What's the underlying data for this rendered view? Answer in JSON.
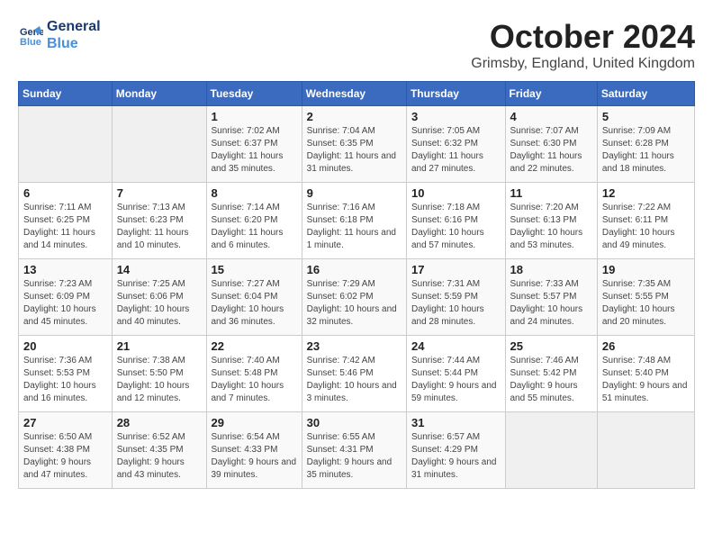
{
  "header": {
    "logo_line1": "General",
    "logo_line2": "Blue",
    "month_title": "October 2024",
    "subtitle": "Grimsby, England, United Kingdom"
  },
  "weekdays": [
    "Sunday",
    "Monday",
    "Tuesday",
    "Wednesday",
    "Thursday",
    "Friday",
    "Saturday"
  ],
  "weeks": [
    [
      {
        "day": "",
        "sunrise": "",
        "sunset": "",
        "daylight": ""
      },
      {
        "day": "",
        "sunrise": "",
        "sunset": "",
        "daylight": ""
      },
      {
        "day": "1",
        "sunrise": "Sunrise: 7:02 AM",
        "sunset": "Sunset: 6:37 PM",
        "daylight": "Daylight: 11 hours and 35 minutes."
      },
      {
        "day": "2",
        "sunrise": "Sunrise: 7:04 AM",
        "sunset": "Sunset: 6:35 PM",
        "daylight": "Daylight: 11 hours and 31 minutes."
      },
      {
        "day": "3",
        "sunrise": "Sunrise: 7:05 AM",
        "sunset": "Sunset: 6:32 PM",
        "daylight": "Daylight: 11 hours and 27 minutes."
      },
      {
        "day": "4",
        "sunrise": "Sunrise: 7:07 AM",
        "sunset": "Sunset: 6:30 PM",
        "daylight": "Daylight: 11 hours and 22 minutes."
      },
      {
        "day": "5",
        "sunrise": "Sunrise: 7:09 AM",
        "sunset": "Sunset: 6:28 PM",
        "daylight": "Daylight: 11 hours and 18 minutes."
      }
    ],
    [
      {
        "day": "6",
        "sunrise": "Sunrise: 7:11 AM",
        "sunset": "Sunset: 6:25 PM",
        "daylight": "Daylight: 11 hours and 14 minutes."
      },
      {
        "day": "7",
        "sunrise": "Sunrise: 7:13 AM",
        "sunset": "Sunset: 6:23 PM",
        "daylight": "Daylight: 11 hours and 10 minutes."
      },
      {
        "day": "8",
        "sunrise": "Sunrise: 7:14 AM",
        "sunset": "Sunset: 6:20 PM",
        "daylight": "Daylight: 11 hours and 6 minutes."
      },
      {
        "day": "9",
        "sunrise": "Sunrise: 7:16 AM",
        "sunset": "Sunset: 6:18 PM",
        "daylight": "Daylight: 11 hours and 1 minute."
      },
      {
        "day": "10",
        "sunrise": "Sunrise: 7:18 AM",
        "sunset": "Sunset: 6:16 PM",
        "daylight": "Daylight: 10 hours and 57 minutes."
      },
      {
        "day": "11",
        "sunrise": "Sunrise: 7:20 AM",
        "sunset": "Sunset: 6:13 PM",
        "daylight": "Daylight: 10 hours and 53 minutes."
      },
      {
        "day": "12",
        "sunrise": "Sunrise: 7:22 AM",
        "sunset": "Sunset: 6:11 PM",
        "daylight": "Daylight: 10 hours and 49 minutes."
      }
    ],
    [
      {
        "day": "13",
        "sunrise": "Sunrise: 7:23 AM",
        "sunset": "Sunset: 6:09 PM",
        "daylight": "Daylight: 10 hours and 45 minutes."
      },
      {
        "day": "14",
        "sunrise": "Sunrise: 7:25 AM",
        "sunset": "Sunset: 6:06 PM",
        "daylight": "Daylight: 10 hours and 40 minutes."
      },
      {
        "day": "15",
        "sunrise": "Sunrise: 7:27 AM",
        "sunset": "Sunset: 6:04 PM",
        "daylight": "Daylight: 10 hours and 36 minutes."
      },
      {
        "day": "16",
        "sunrise": "Sunrise: 7:29 AM",
        "sunset": "Sunset: 6:02 PM",
        "daylight": "Daylight: 10 hours and 32 minutes."
      },
      {
        "day": "17",
        "sunrise": "Sunrise: 7:31 AM",
        "sunset": "Sunset: 5:59 PM",
        "daylight": "Daylight: 10 hours and 28 minutes."
      },
      {
        "day": "18",
        "sunrise": "Sunrise: 7:33 AM",
        "sunset": "Sunset: 5:57 PM",
        "daylight": "Daylight: 10 hours and 24 minutes."
      },
      {
        "day": "19",
        "sunrise": "Sunrise: 7:35 AM",
        "sunset": "Sunset: 5:55 PM",
        "daylight": "Daylight: 10 hours and 20 minutes."
      }
    ],
    [
      {
        "day": "20",
        "sunrise": "Sunrise: 7:36 AM",
        "sunset": "Sunset: 5:53 PM",
        "daylight": "Daylight: 10 hours and 16 minutes."
      },
      {
        "day": "21",
        "sunrise": "Sunrise: 7:38 AM",
        "sunset": "Sunset: 5:50 PM",
        "daylight": "Daylight: 10 hours and 12 minutes."
      },
      {
        "day": "22",
        "sunrise": "Sunrise: 7:40 AM",
        "sunset": "Sunset: 5:48 PM",
        "daylight": "Daylight: 10 hours and 7 minutes."
      },
      {
        "day": "23",
        "sunrise": "Sunrise: 7:42 AM",
        "sunset": "Sunset: 5:46 PM",
        "daylight": "Daylight: 10 hours and 3 minutes."
      },
      {
        "day": "24",
        "sunrise": "Sunrise: 7:44 AM",
        "sunset": "Sunset: 5:44 PM",
        "daylight": "Daylight: 9 hours and 59 minutes."
      },
      {
        "day": "25",
        "sunrise": "Sunrise: 7:46 AM",
        "sunset": "Sunset: 5:42 PM",
        "daylight": "Daylight: 9 hours and 55 minutes."
      },
      {
        "day": "26",
        "sunrise": "Sunrise: 7:48 AM",
        "sunset": "Sunset: 5:40 PM",
        "daylight": "Daylight: 9 hours and 51 minutes."
      }
    ],
    [
      {
        "day": "27",
        "sunrise": "Sunrise: 6:50 AM",
        "sunset": "Sunset: 4:38 PM",
        "daylight": "Daylight: 9 hours and 47 minutes."
      },
      {
        "day": "28",
        "sunrise": "Sunrise: 6:52 AM",
        "sunset": "Sunset: 4:35 PM",
        "daylight": "Daylight: 9 hours and 43 minutes."
      },
      {
        "day": "29",
        "sunrise": "Sunrise: 6:54 AM",
        "sunset": "Sunset: 4:33 PM",
        "daylight": "Daylight: 9 hours and 39 minutes."
      },
      {
        "day": "30",
        "sunrise": "Sunrise: 6:55 AM",
        "sunset": "Sunset: 4:31 PM",
        "daylight": "Daylight: 9 hours and 35 minutes."
      },
      {
        "day": "31",
        "sunrise": "Sunrise: 6:57 AM",
        "sunset": "Sunset: 4:29 PM",
        "daylight": "Daylight: 9 hours and 31 minutes."
      },
      {
        "day": "",
        "sunrise": "",
        "sunset": "",
        "daylight": ""
      },
      {
        "day": "",
        "sunrise": "",
        "sunset": "",
        "daylight": ""
      }
    ]
  ]
}
